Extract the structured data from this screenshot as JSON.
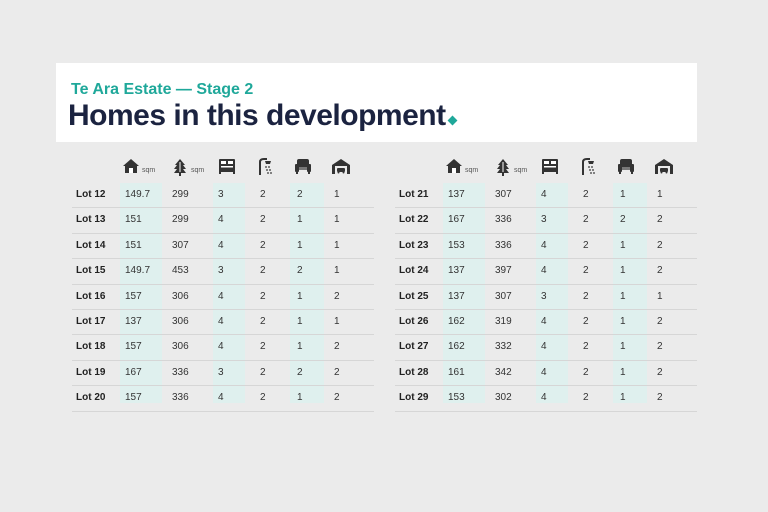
{
  "header": {
    "subtitle": "Te Ara Estate — Stage 2",
    "title": "Homes in this development"
  },
  "colors": {
    "accent": "#1fa89a",
    "title": "#1b2340",
    "shade": "#dff0ee"
  },
  "columns": {
    "house_icon": "house-icon",
    "house_unit": "sqm",
    "land_icon": "tree-icon",
    "land_unit": "sqm",
    "bed_icon": "bed-icon",
    "bath_icon": "shower-icon",
    "living_icon": "armchair-icon",
    "garage_icon": "garage-icon"
  },
  "left": [
    [
      "Lot 12",
      "149.7",
      "299",
      "3",
      "2",
      "2",
      "1"
    ],
    [
      "Lot 13",
      "151",
      "299",
      "4",
      "2",
      "1",
      "1"
    ],
    [
      "Lot 14",
      "151",
      "307",
      "4",
      "2",
      "1",
      "1"
    ],
    [
      "Lot 15",
      "149.7",
      "453",
      "3",
      "2",
      "2",
      "1"
    ],
    [
      "Lot 16",
      "157",
      "306",
      "4",
      "2",
      "1",
      "2"
    ],
    [
      "Lot 17",
      "137",
      "306",
      "4",
      "2",
      "1",
      "1"
    ],
    [
      "Lot 18",
      "157",
      "306",
      "4",
      "2",
      "1",
      "2"
    ],
    [
      "Lot 19",
      "167",
      "336",
      "3",
      "2",
      "2",
      "2"
    ],
    [
      "Lot 20",
      "157",
      "336",
      "4",
      "2",
      "1",
      "2"
    ]
  ],
  "right": [
    [
      "Lot 21",
      "137",
      "307",
      "4",
      "2",
      "1",
      "1"
    ],
    [
      "Lot 22",
      "167",
      "336",
      "3",
      "2",
      "2",
      "2"
    ],
    [
      "Lot 23",
      "153",
      "336",
      "4",
      "2",
      "1",
      "2"
    ],
    [
      "Lot 24",
      "137",
      "397",
      "4",
      "2",
      "1",
      "2"
    ],
    [
      "Lot 25",
      "137",
      "307",
      "3",
      "2",
      "1",
      "1"
    ],
    [
      "Lot 26",
      "162",
      "319",
      "4",
      "2",
      "1",
      "2"
    ],
    [
      "Lot 27",
      "162",
      "332",
      "4",
      "2",
      "1",
      "2"
    ],
    [
      "Lot 28",
      "161",
      "342",
      "4",
      "2",
      "1",
      "2"
    ],
    [
      "Lot 29",
      "153",
      "302",
      "4",
      "2",
      "1",
      "2"
    ]
  ]
}
